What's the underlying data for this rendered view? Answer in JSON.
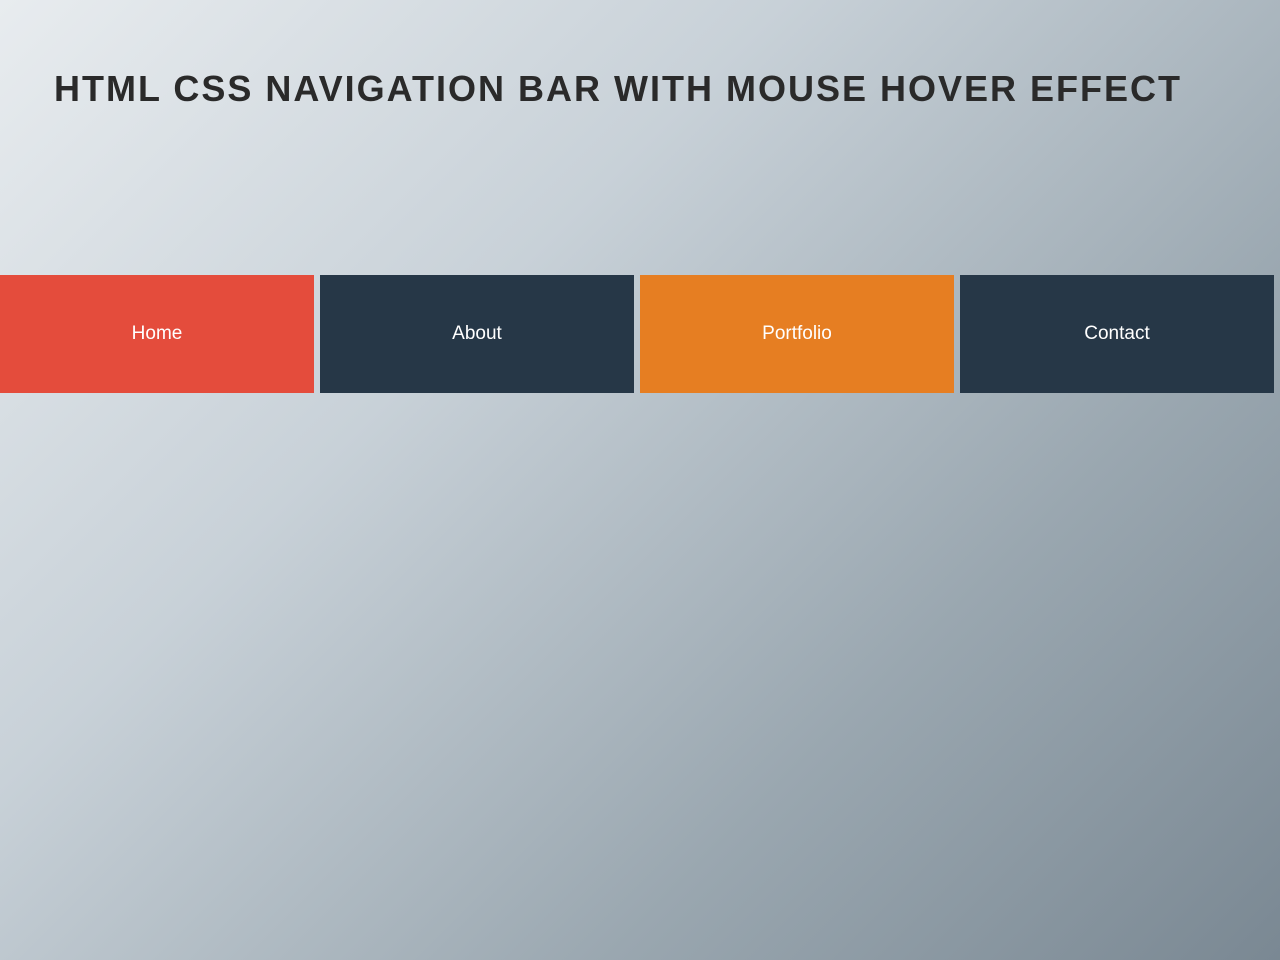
{
  "title": "HTML CSS NAVIGATION BAR WITH MOUSE HOVER EFFECT",
  "nav": {
    "items": [
      {
        "label": "Home",
        "state": "active"
      },
      {
        "label": "About",
        "state": "default"
      },
      {
        "label": "Portfolio",
        "state": "hover"
      },
      {
        "label": "Contact",
        "state": "default"
      }
    ]
  },
  "colors": {
    "nav_default": "#263747",
    "nav_active": "#e44c3c",
    "nav_hover": "#e67e22",
    "title": "#2a2a2a"
  }
}
